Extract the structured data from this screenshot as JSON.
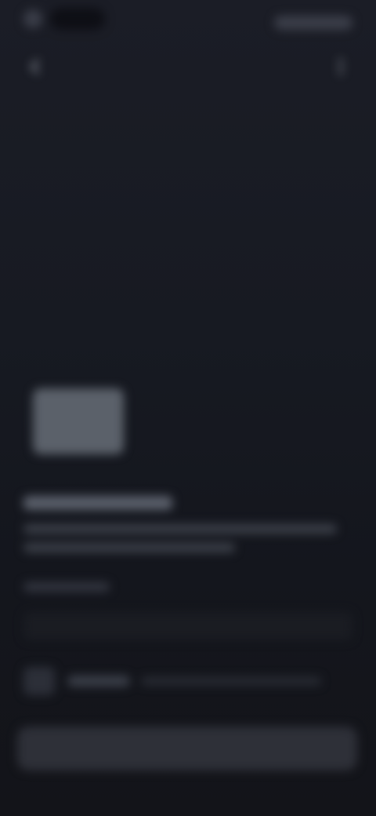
{
  "status_bar": {
    "time": "",
    "indicators": ""
  },
  "nav": {
    "left_icon": "back-icon",
    "right_icon": "more-icon"
  },
  "content": {
    "title": "",
    "description": "",
    "section_label": "",
    "field_value": "",
    "row_label": "",
    "row_detail": ""
  },
  "primary_button": {
    "label": ""
  }
}
